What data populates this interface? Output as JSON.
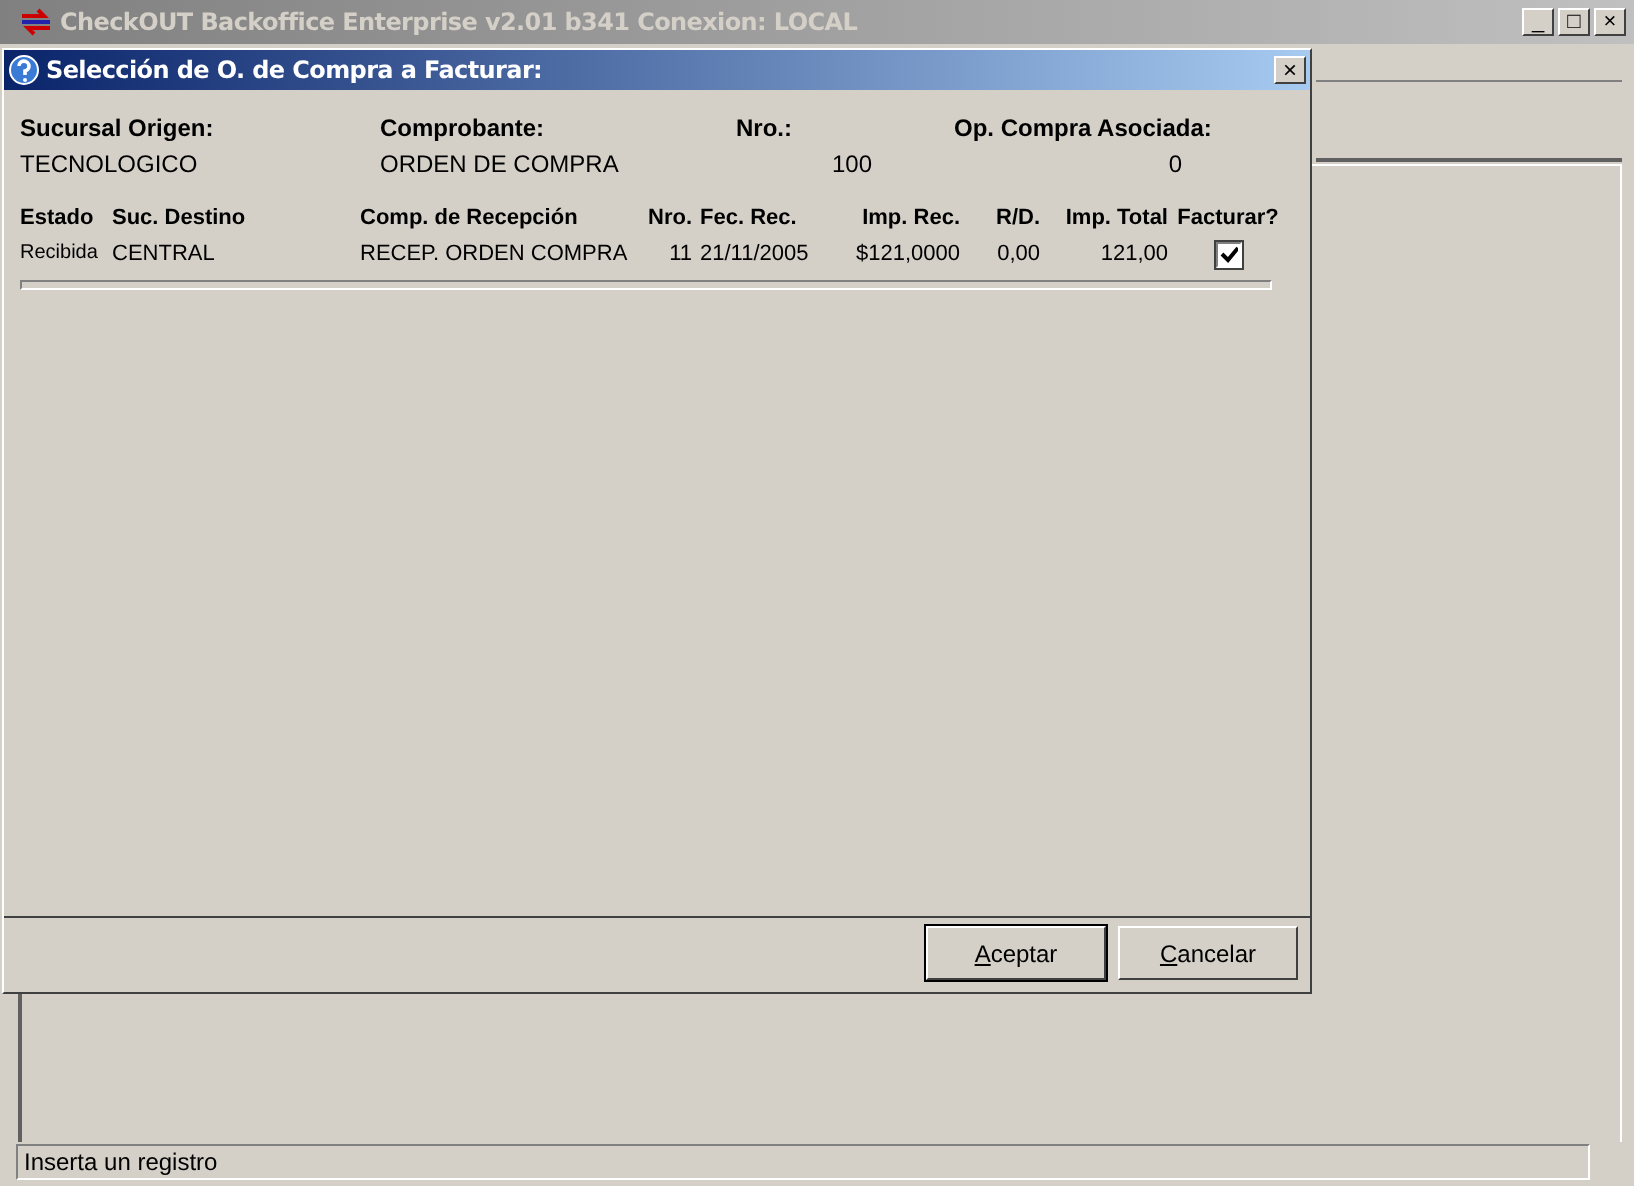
{
  "window": {
    "title": "CheckOUT Backoffice Enterprise v2.01 b341 Conexion: LOCAL",
    "controls": [
      "_",
      "□",
      "×"
    ]
  },
  "dialog": {
    "title": "Selección de O. de Compra a Facturar:",
    "close": "×",
    "header_fields": [
      {
        "label": "Sucursal Origen:",
        "value": "TECNOLOGICO"
      },
      {
        "label": "Comprobante:",
        "value": "ORDEN DE COMPRA"
      },
      {
        "label": "Nro.:",
        "value": "100"
      },
      {
        "label": "Op. Compra Asociada:",
        "value": "0"
      }
    ],
    "table": {
      "columns": [
        "Estado",
        "Suc. Destino",
        "Comp. de Recepción",
        "Nro.",
        "Fec. Rec.",
        "Imp. Rec.",
        "R/D.",
        "Imp. Total",
        "Facturar?"
      ],
      "rows": [
        {
          "cells": [
            "Recibida",
            "CENTRAL",
            "RECEP. ORDEN COMPRA",
            "11",
            "21/11/2005",
            "$121,0000",
            "0,00",
            "121,00"
          ],
          "checked": true
        }
      ]
    },
    "buttons": [
      {
        "label": "Aceptar",
        "default": true
      },
      {
        "label": "Cancelar",
        "default": false
      }
    ]
  },
  "status_bar": "Inserta un registro"
}
